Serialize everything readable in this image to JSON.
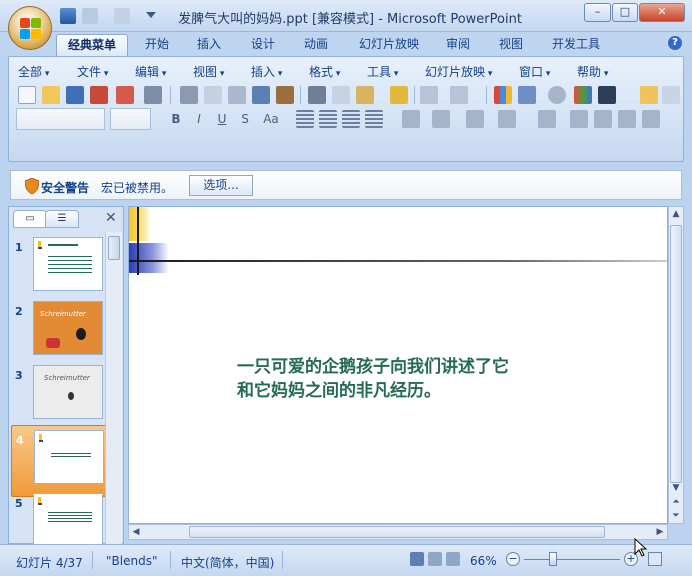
{
  "window": {
    "title": "发脾气大叫的妈妈.ppt [兼容模式] - Microsoft PowerPoint",
    "controls": {
      "minimize": "–",
      "maximize": "□",
      "close": "✕"
    }
  },
  "ribbon_tabs": [
    "经典菜单",
    "开始",
    "插入",
    "设计",
    "动画",
    "幻灯片放映",
    "审阅",
    "视图",
    "开发工具"
  ],
  "active_tab": "经典菜单",
  "help_label": "?",
  "menus": [
    "全部",
    "文件",
    "编辑",
    "视图",
    "插入",
    "格式",
    "工具",
    "幻灯片放映",
    "窗口",
    "帮助"
  ],
  "format_buttons": [
    "B",
    "I",
    "U",
    "S",
    "Aa"
  ],
  "security_bar": {
    "title": "安全警告",
    "message": "宏已被禁用。",
    "options_button": "选项..."
  },
  "slide_panel": {
    "close_label": "✕",
    "slides": [
      {
        "number": "1"
      },
      {
        "number": "2",
        "thumb_title": "Schreimutter"
      },
      {
        "number": "3",
        "thumb_title": "Schreimutter"
      },
      {
        "number": "4",
        "selected": true
      },
      {
        "number": "5"
      }
    ]
  },
  "slide": {
    "body_line1": "一只可爱的企鹅孩子向我们讲述了它",
    "body_line2": "和它妈妈之间的非凡经历。",
    "text_color": "#256b56",
    "accent_colors": [
      "#f7c21a",
      "#2b3db8"
    ]
  },
  "status": {
    "slide_info": "幻灯片 4/37",
    "theme": "\"Blends\"",
    "language": "中文(简体，中国)",
    "zoom": "66%",
    "zoom_minus": "−",
    "zoom_plus": "+"
  }
}
